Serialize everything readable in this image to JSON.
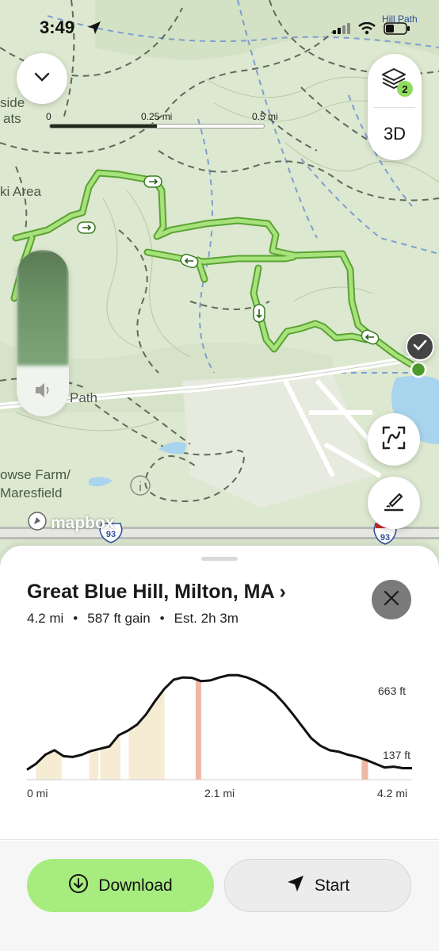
{
  "status_bar": {
    "time": "3:49",
    "corner_label": "Hill Path"
  },
  "map": {
    "scale": {
      "labels": [
        "0",
        "0.25 mi",
        "0.5 mi"
      ]
    },
    "labels": {
      "side_a": "side",
      "side_b": "ats",
      "ski_area": "ki Area",
      "path": "Path",
      "farm_a": "owse Farm/",
      "farm_b": "Maresfield"
    },
    "route_shields": [
      "93",
      "93"
    ],
    "layers_badge": "2",
    "view_3d": "3D",
    "attribution": "mapbox",
    "colors": {
      "trail": "#8fd35f",
      "trail_edge": "#5aa234",
      "water": "#a9d4ee",
      "land": "#dde8d0"
    }
  },
  "route": {
    "title": "Great Blue Hill, Milton, MA ›",
    "distance": "4.2 mi",
    "gain": "587 ft gain",
    "estimate": "Est. 2h 3m",
    "separator": "•"
  },
  "chart_data": {
    "type": "area",
    "xlabel": "",
    "ylabel": "",
    "x_ticks": [
      "0 mi",
      "2.1 mi",
      "4.2 mi"
    ],
    "y_ticks": [
      "663 ft",
      "137 ft"
    ],
    "xlim": [
      0,
      4.2
    ],
    "ylim": [
      60,
      800
    ],
    "x": [
      0,
      0.1,
      0.2,
      0.3,
      0.4,
      0.5,
      0.6,
      0.7,
      0.8,
      0.9,
      1.0,
      1.1,
      1.2,
      1.3,
      1.4,
      1.5,
      1.6,
      1.7,
      1.8,
      1.9,
      2.0,
      2.1,
      2.2,
      2.3,
      2.4,
      2.5,
      2.6,
      2.7,
      2.8,
      2.9,
      3.0,
      3.1,
      3.2,
      3.3,
      3.4,
      3.5,
      3.6,
      3.7,
      3.8,
      3.9,
      4.0,
      4.1,
      4.2
    ],
    "y": [
      100,
      140,
      200,
      230,
      190,
      185,
      200,
      225,
      240,
      255,
      330,
      360,
      400,
      470,
      560,
      640,
      700,
      715,
      712,
      690,
      695,
      715,
      730,
      730,
      715,
      690,
      655,
      610,
      545,
      470,
      390,
      310,
      260,
      230,
      220,
      200,
      185,
      165,
      140,
      115,
      120,
      110,
      110
    ],
    "shaded_segments": [
      {
        "from": 0.1,
        "to": 0.38,
        "grade": "moderate"
      },
      {
        "from": 0.68,
        "to": 0.78,
        "grade": "moderate"
      },
      {
        "from": 0.8,
        "to": 1.02,
        "grade": "moderate"
      },
      {
        "from": 1.11,
        "to": 1.5,
        "grade": "moderate"
      },
      {
        "from": 1.84,
        "to": 1.9,
        "grade": "steep"
      },
      {
        "from": 3.65,
        "to": 3.72,
        "grade": "steep"
      }
    ],
    "colors": {
      "line": "#111111",
      "moderate": "#f6ecd4",
      "steep": "#eeb8a4"
    }
  },
  "actions": {
    "download": "Download",
    "start": "Start"
  }
}
